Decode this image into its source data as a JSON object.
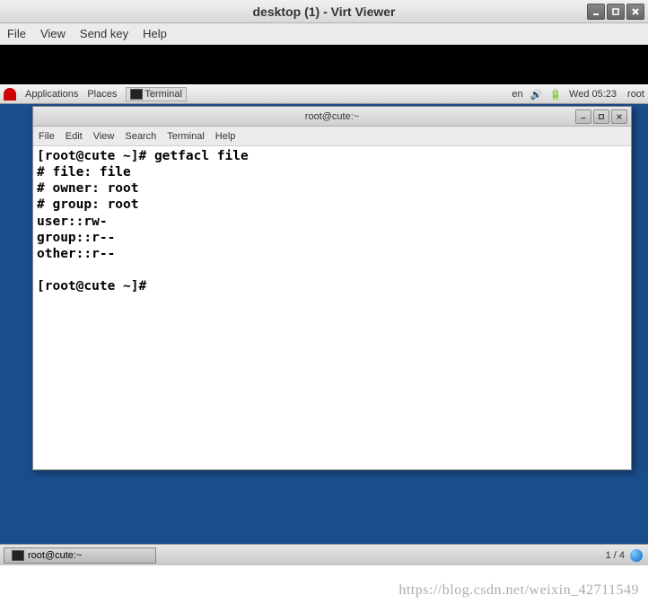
{
  "virt": {
    "title": "desktop (1) - Virt Viewer",
    "menu": {
      "file": "File",
      "view": "View",
      "sendkey": "Send key",
      "help": "Help"
    }
  },
  "guest_panel": {
    "applications": "Applications",
    "places": "Places",
    "terminal": "Terminal",
    "lang": "en",
    "clock": "Wed 05:23",
    "user": "root"
  },
  "terminal": {
    "title": "root@cute:~",
    "menu": {
      "file": "File",
      "edit": "Edit",
      "view": "View",
      "search": "Search",
      "terminal": "Terminal",
      "help": "Help"
    },
    "lines": [
      "[root@cute ~]# getfacl file",
      "# file: file",
      "# owner: root",
      "# group: root",
      "user::rw-",
      "group::r--",
      "other::r--",
      "",
      "[root@cute ~]# "
    ]
  },
  "taskbar": {
    "item": "root@cute:~",
    "workspace": "1 / 4"
  },
  "watermark": "https://blog.csdn.net/weixin_42711549"
}
